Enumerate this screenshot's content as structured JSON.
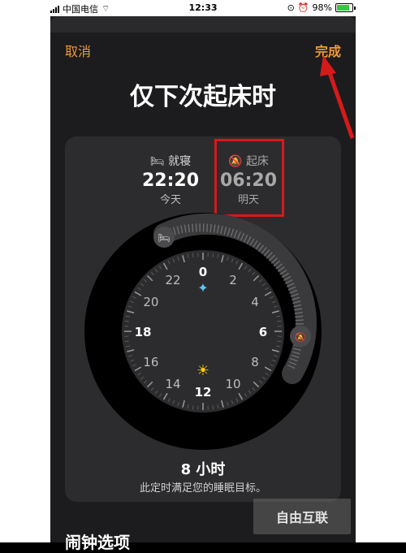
{
  "status_bar": {
    "carrier": "中国电信",
    "time": "12:33",
    "battery": "98%"
  },
  "nav": {
    "cancel_label": "取消",
    "done_label": "完成"
  },
  "title": "仅下次起床时",
  "bedtime": {
    "label": "就寝",
    "time": "22:20",
    "day": "今天"
  },
  "wake": {
    "label": "起床",
    "time": "06:20",
    "day": "明天"
  },
  "clock": {
    "hour_labels": [
      "0",
      "2",
      "4",
      "6",
      "8",
      "10",
      "12",
      "14",
      "16",
      "18",
      "20",
      "22"
    ]
  },
  "summary": {
    "hours": "8 小时",
    "message": "此定时满足您的睡眠目标。"
  },
  "section": {
    "alarm_options": "闹钟选项"
  },
  "watermark": "自由互联",
  "colors": {
    "accent": "#f09a37",
    "highlight": "#d61a1a",
    "sheet": "#1c1c1e",
    "card": "#2c2c2e"
  }
}
